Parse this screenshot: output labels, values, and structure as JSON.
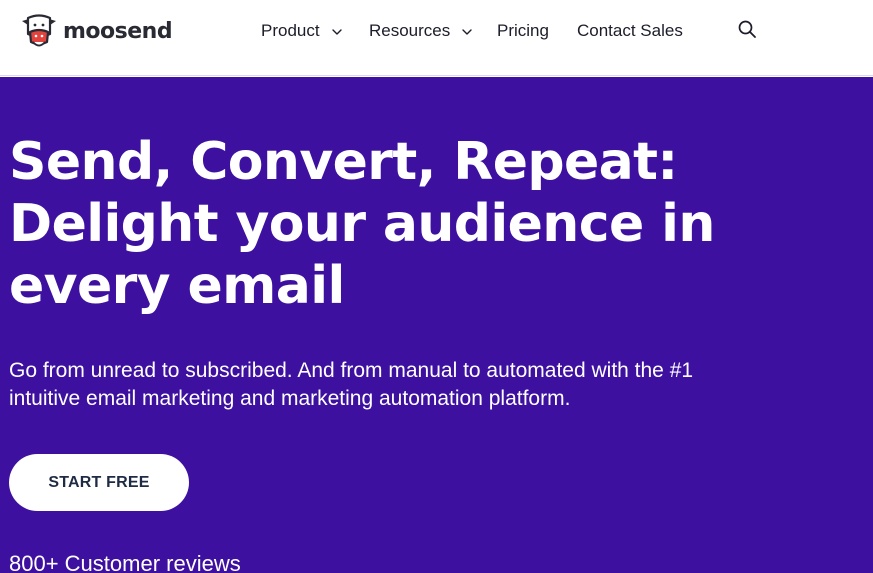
{
  "brand": {
    "name": "moosend",
    "logo_icon": "cow-mascot-icon"
  },
  "nav": {
    "items": [
      {
        "label": "Product",
        "has_dropdown": true
      },
      {
        "label": "Resources",
        "has_dropdown": true
      },
      {
        "label": "Pricing",
        "has_dropdown": false
      },
      {
        "label": "Contact Sales",
        "has_dropdown": false
      }
    ],
    "search_icon": "search-icon"
  },
  "hero": {
    "headline_lines": [
      "Send, Convert, Repeat:",
      "Delight your audience in",
      "every email"
    ],
    "subtext": "Go from unread to subscribed. And from manual to automated with the #1 intuitive email marketing and marketing automation platform.",
    "cta_label": "START FREE",
    "reviews_text": "800+ Customer reviews"
  },
  "colors": {
    "hero_background": "#3d10a0",
    "header_background": "#ffffff",
    "cta_background": "#ffffff",
    "cta_text": "#1f2a44",
    "nav_text": "#1c1c2b"
  }
}
